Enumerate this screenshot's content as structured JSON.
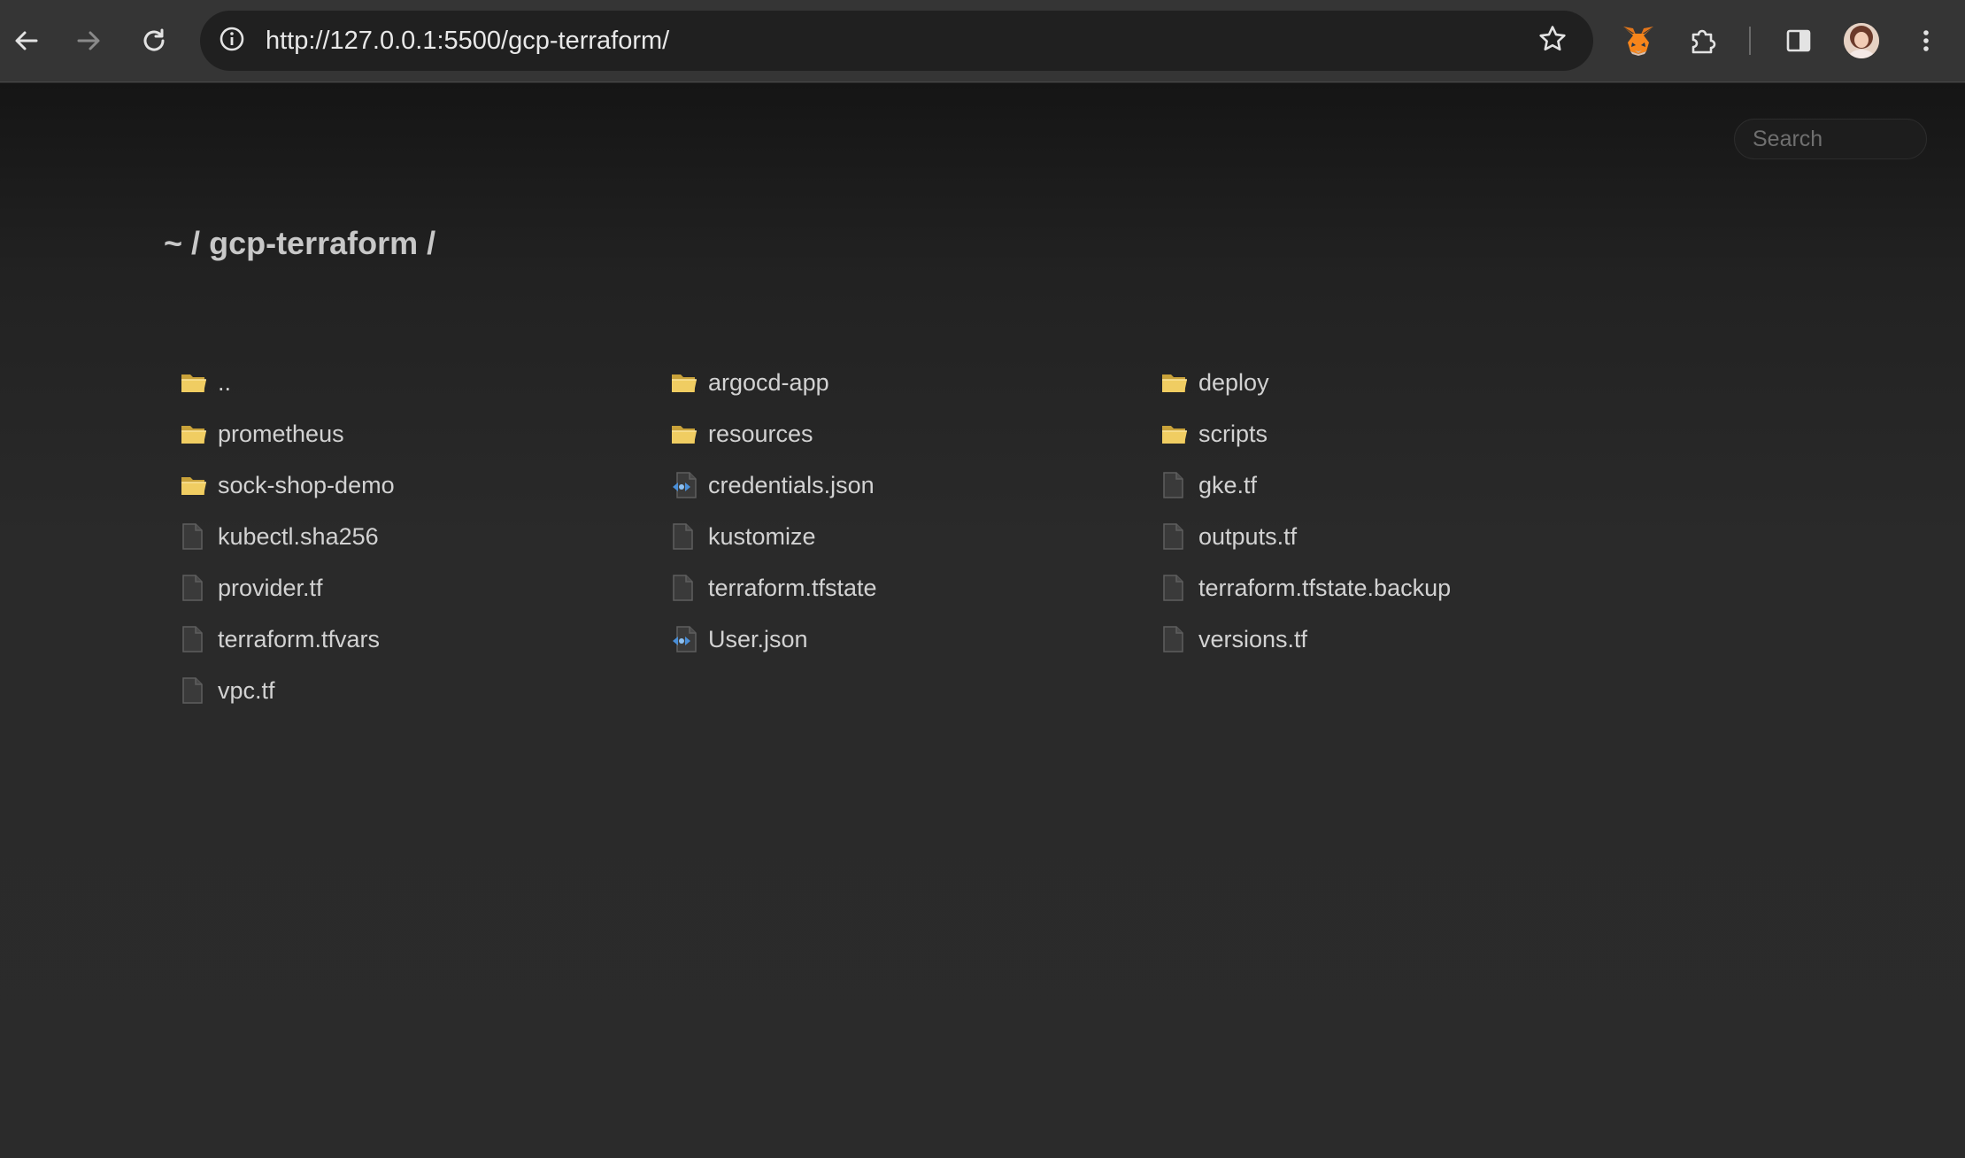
{
  "browser": {
    "url": "http://127.0.0.1:5500/gcp-terraform/",
    "icons": {
      "back": "arrow-left-icon",
      "forward": "arrow-right-icon",
      "reload": "reload-icon",
      "site_info": "info-icon",
      "bookmark": "star-icon",
      "metamask": "fox-icon",
      "extensions": "puzzle-icon",
      "side_panel": "side-panel-icon",
      "menu": "kebab-menu-icon"
    }
  },
  "page": {
    "search_placeholder": "Search",
    "breadcrumb": {
      "home": "~",
      "separator": "/",
      "current": "gcp-terraform"
    },
    "entries": [
      {
        "name": "..",
        "type": "folder"
      },
      {
        "name": "argocd-app",
        "type": "folder"
      },
      {
        "name": "deploy",
        "type": "folder"
      },
      {
        "name": "prometheus",
        "type": "folder"
      },
      {
        "name": "resources",
        "type": "folder"
      },
      {
        "name": "scripts",
        "type": "folder"
      },
      {
        "name": "sock-shop-demo",
        "type": "folder"
      },
      {
        "name": "credentials.json",
        "type": "json"
      },
      {
        "name": "gke.tf",
        "type": "file"
      },
      {
        "name": "kubectl.sha256",
        "type": "file"
      },
      {
        "name": "kustomize",
        "type": "file"
      },
      {
        "name": "outputs.tf",
        "type": "file"
      },
      {
        "name": "provider.tf",
        "type": "file"
      },
      {
        "name": "terraform.tfstate",
        "type": "file"
      },
      {
        "name": "terraform.tfstate.backup",
        "type": "file"
      },
      {
        "name": "terraform.tfvars",
        "type": "file"
      },
      {
        "name": "User.json",
        "type": "json"
      },
      {
        "name": "versions.tf",
        "type": "file"
      },
      {
        "name": "vpc.tf",
        "type": "file"
      }
    ]
  },
  "colors": {
    "toolbar": "#353535",
    "omnibox": "#202020",
    "page_bg": "#2b2b2b",
    "folder": "#e8c45a",
    "json_accent": "#4a8fd8"
  }
}
